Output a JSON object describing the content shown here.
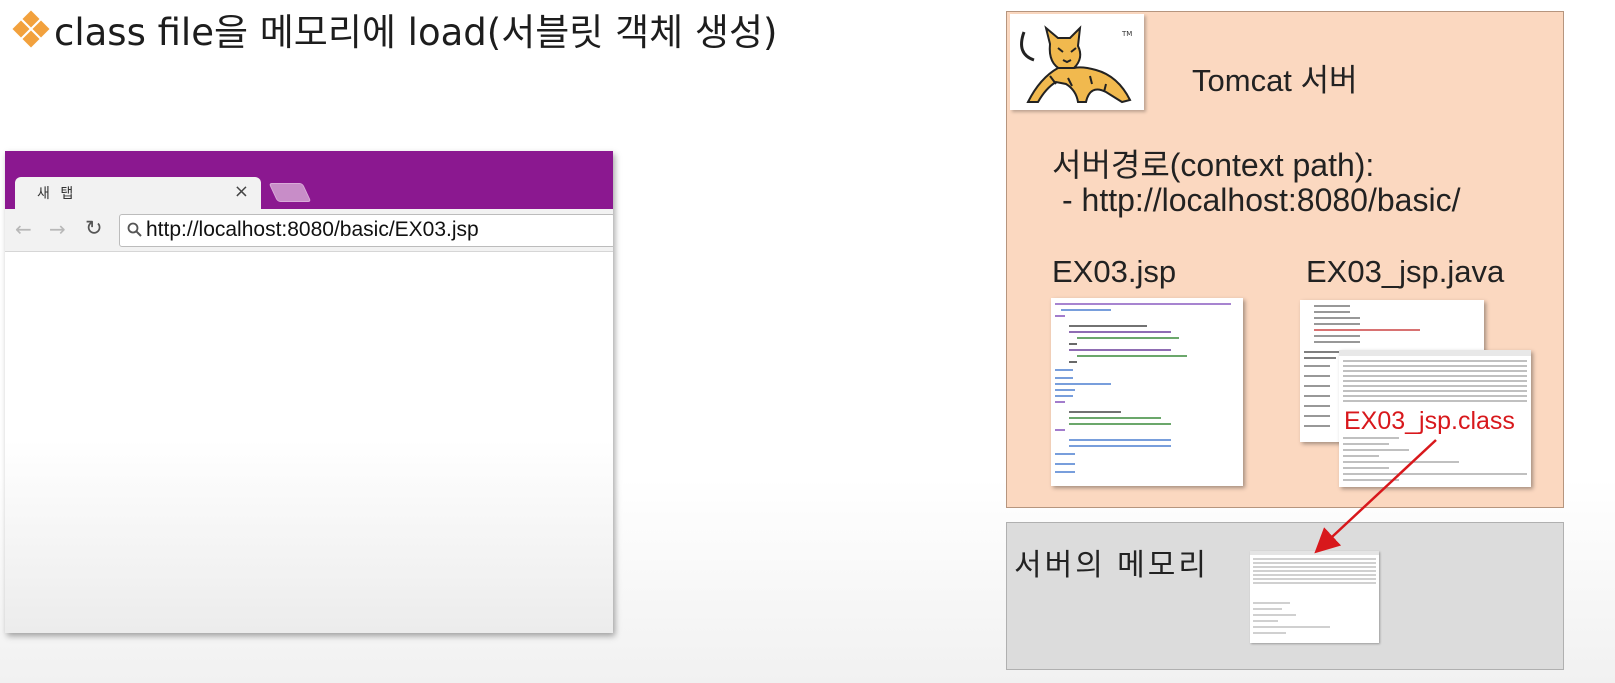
{
  "slide": {
    "title": "class file을 메모리에 load(서블릿 객체 생성)"
  },
  "browser": {
    "tab_label": "새 탭",
    "close_glyph": "×",
    "back_glyph": "←",
    "forward_glyph": "→",
    "reload_glyph": "↻",
    "url": "http://localhost:8080/basic/EX03.jsp"
  },
  "server": {
    "name": "Tomcat 서버",
    "context_path_label": "서버경로(context path):",
    "context_path_value": "- http://localhost:8080/basic/",
    "jsp_file": "EX03.jsp",
    "java_file": "EX03_jsp.java",
    "class_file": "EX03_jsp.class"
  },
  "memory": {
    "label": "서버의 메모리"
  },
  "colors": {
    "browser_frame": "#8b1890",
    "server_box": "#fbd8c0",
    "memory_box": "#dcdcdc",
    "class_label": "#d8181c",
    "bullet": "#f2a13d"
  },
  "icons": [
    "diamond-bullet-icon",
    "tomcat-logo",
    "search-icon",
    "close-icon",
    "back-arrow-icon",
    "forward-arrow-icon",
    "reload-icon"
  ]
}
